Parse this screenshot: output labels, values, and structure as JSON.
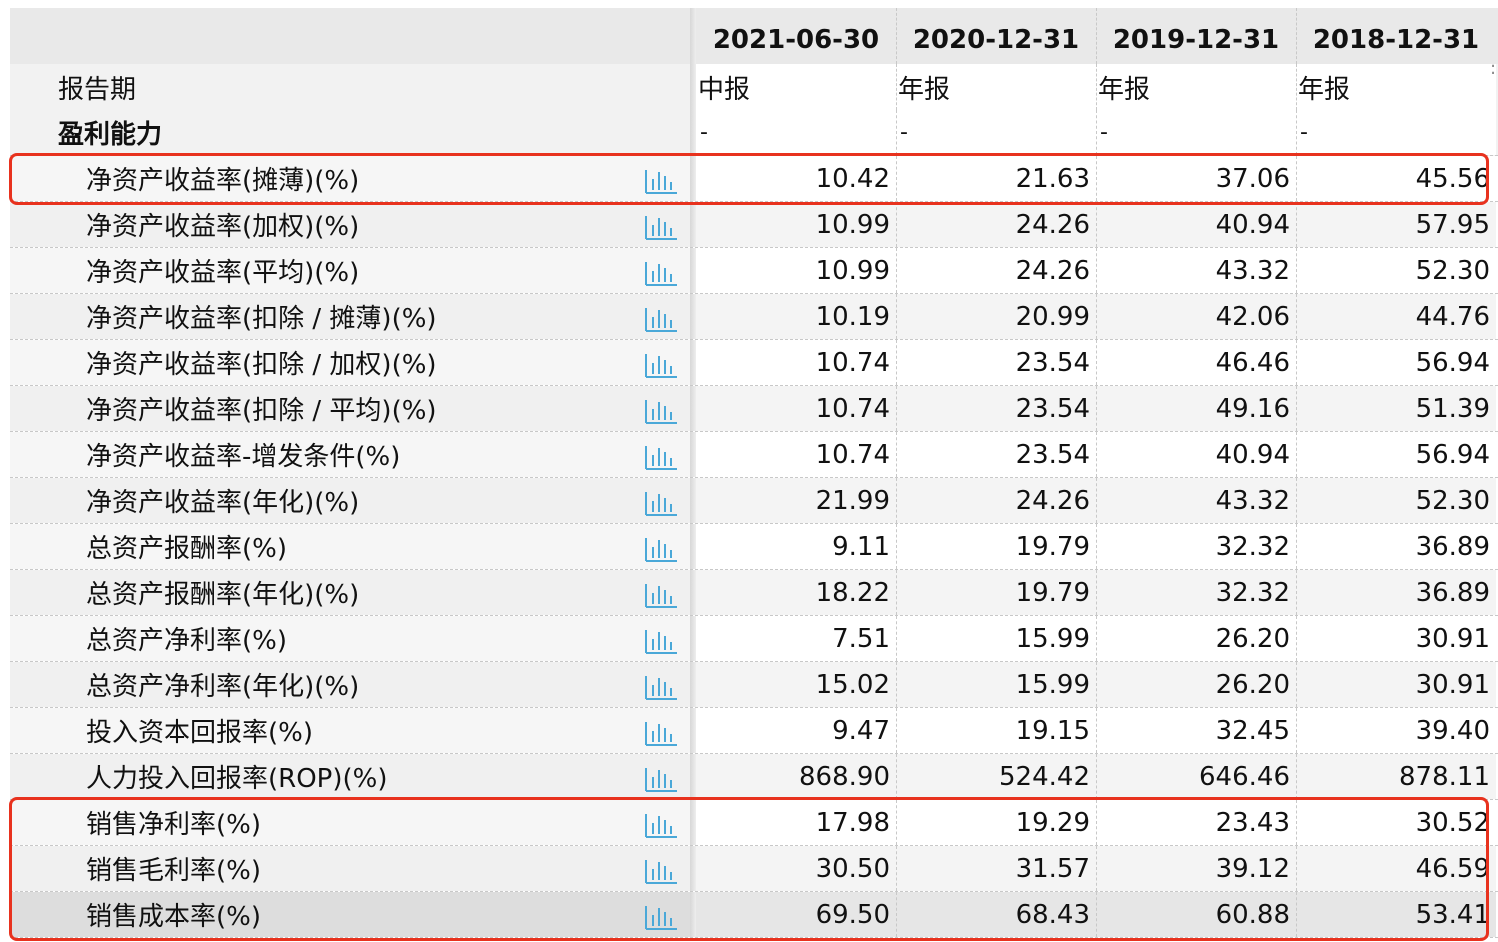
{
  "table": {
    "columns": [
      {
        "date": "2021-06-30",
        "period": "中报"
      },
      {
        "date": "2020-12-31",
        "period": "年报"
      },
      {
        "date": "2019-12-31",
        "period": "年报"
      },
      {
        "date": "2018-12-31",
        "period": "年报"
      }
    ],
    "report_period_label": "报告期",
    "section_label": "盈利能力",
    "section_placeholders": [
      "-",
      "-",
      "-",
      "-"
    ],
    "rows": [
      {
        "label": "净资产收益率(摊薄)(%)",
        "values": [
          "10.42",
          "21.63",
          "37.06",
          "45.56"
        ],
        "highlighted": true
      },
      {
        "label": "净资产收益率(加权)(%)",
        "values": [
          "10.99",
          "24.26",
          "40.94",
          "57.95"
        ]
      },
      {
        "label": "净资产收益率(平均)(%)",
        "values": [
          "10.99",
          "24.26",
          "43.32",
          "52.30"
        ]
      },
      {
        "label": "净资产收益率(扣除 / 摊薄)(%)",
        "values": [
          "10.19",
          "20.99",
          "42.06",
          "44.76"
        ]
      },
      {
        "label": "净资产收益率(扣除 / 加权)(%)",
        "values": [
          "10.74",
          "23.54",
          "46.46",
          "56.94"
        ]
      },
      {
        "label": "净资产收益率(扣除 / 平均)(%)",
        "values": [
          "10.74",
          "23.54",
          "49.16",
          "51.39"
        ]
      },
      {
        "label": "净资产收益率-增发条件(%)",
        "values": [
          "10.74",
          "23.54",
          "40.94",
          "56.94"
        ]
      },
      {
        "label": "净资产收益率(年化)(%)",
        "values": [
          "21.99",
          "24.26",
          "43.32",
          "52.30"
        ]
      },
      {
        "label": "总资产报酬率(%)",
        "values": [
          "9.11",
          "19.79",
          "32.32",
          "36.89"
        ]
      },
      {
        "label": "总资产报酬率(年化)(%)",
        "values": [
          "18.22",
          "19.79",
          "32.32",
          "36.89"
        ]
      },
      {
        "label": "总资产净利率(%)",
        "values": [
          "7.51",
          "15.99",
          "26.20",
          "30.91"
        ]
      },
      {
        "label": "总资产净利率(年化)(%)",
        "values": [
          "15.02",
          "15.99",
          "26.20",
          "30.91"
        ]
      },
      {
        "label": "投入资本回报率(%)",
        "values": [
          "9.47",
          "19.15",
          "32.45",
          "39.40"
        ]
      },
      {
        "label": "人力投入回报率(ROP)(%)",
        "values": [
          "868.90",
          "524.42",
          "646.46",
          "878.11"
        ]
      },
      {
        "label": "销售净利率(%)",
        "values": [
          "17.98",
          "19.29",
          "23.43",
          "30.52"
        ],
        "highlighted": true
      },
      {
        "label": "销售毛利率(%)",
        "values": [
          "30.50",
          "31.57",
          "39.12",
          "46.59"
        ],
        "highlighted": true
      },
      {
        "label": "销售成本率(%)",
        "values": [
          "69.50",
          "68.43",
          "60.88",
          "53.41"
        ],
        "highlighted": true
      }
    ]
  },
  "icons": {
    "row_chart": "bar-chart-icon"
  },
  "colors": {
    "highlight_border": "#e8321e",
    "chart_icon": "#4aa8d8",
    "header_bg": "#e9e9e9",
    "label_bg": "#f2f2f2"
  }
}
